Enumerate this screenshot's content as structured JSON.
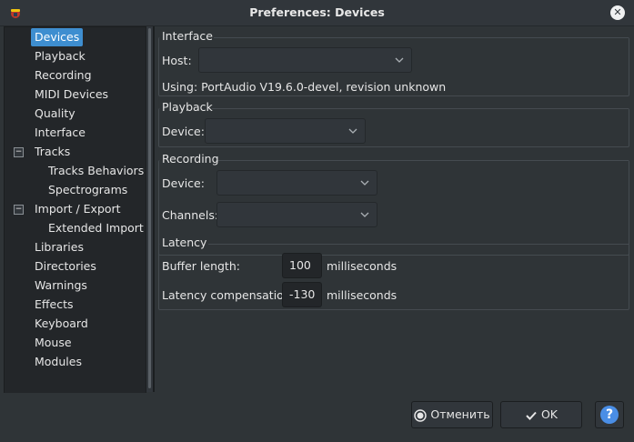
{
  "window": {
    "title": "Preferences: Devices"
  },
  "sidebar": {
    "items": [
      {
        "label": "Devices",
        "level": 0,
        "selected": true
      },
      {
        "label": "Playback",
        "level": 0
      },
      {
        "label": "Recording",
        "level": 0
      },
      {
        "label": "MIDI Devices",
        "level": 0
      },
      {
        "label": "Quality",
        "level": 0
      },
      {
        "label": "Interface",
        "level": 0
      },
      {
        "label": "Tracks",
        "level": 0,
        "expanded": true
      },
      {
        "label": "Tracks Behaviors",
        "level": 1
      },
      {
        "label": "Spectrograms",
        "level": 1
      },
      {
        "label": "Import / Export",
        "level": 0,
        "expanded": true
      },
      {
        "label": "Extended Import",
        "level": 1
      },
      {
        "label": "Libraries",
        "level": 0
      },
      {
        "label": "Directories",
        "level": 0
      },
      {
        "label": "Warnings",
        "level": 0
      },
      {
        "label": "Effects",
        "level": 0
      },
      {
        "label": "Keyboard",
        "level": 0
      },
      {
        "label": "Mouse",
        "level": 0
      },
      {
        "label": "Modules",
        "level": 0
      }
    ]
  },
  "interface": {
    "title": "Interface",
    "host_label": "Host:",
    "host_value": "",
    "using_text": "Using: PortAudio V19.6.0-devel, revision unknown"
  },
  "playback": {
    "title": "Playback",
    "device_label": "Device:",
    "device_value": ""
  },
  "recording": {
    "title": "Recording",
    "device_label": "Device:",
    "device_value": "",
    "channels_label": "Channels:",
    "channels_value": ""
  },
  "latency": {
    "title": "Latency",
    "buffer_label": "Buffer length:",
    "buffer_value": "100",
    "buffer_unit": "milliseconds",
    "comp_label": "Latency compensation:",
    "comp_value": "-130",
    "comp_unit": "milliseconds"
  },
  "buttons": {
    "cancel_label": "Отменить",
    "ok_label": "OK",
    "help_label": "?"
  },
  "colors": {
    "accent": "#3e8ed0",
    "help": "#4a8ee6"
  }
}
